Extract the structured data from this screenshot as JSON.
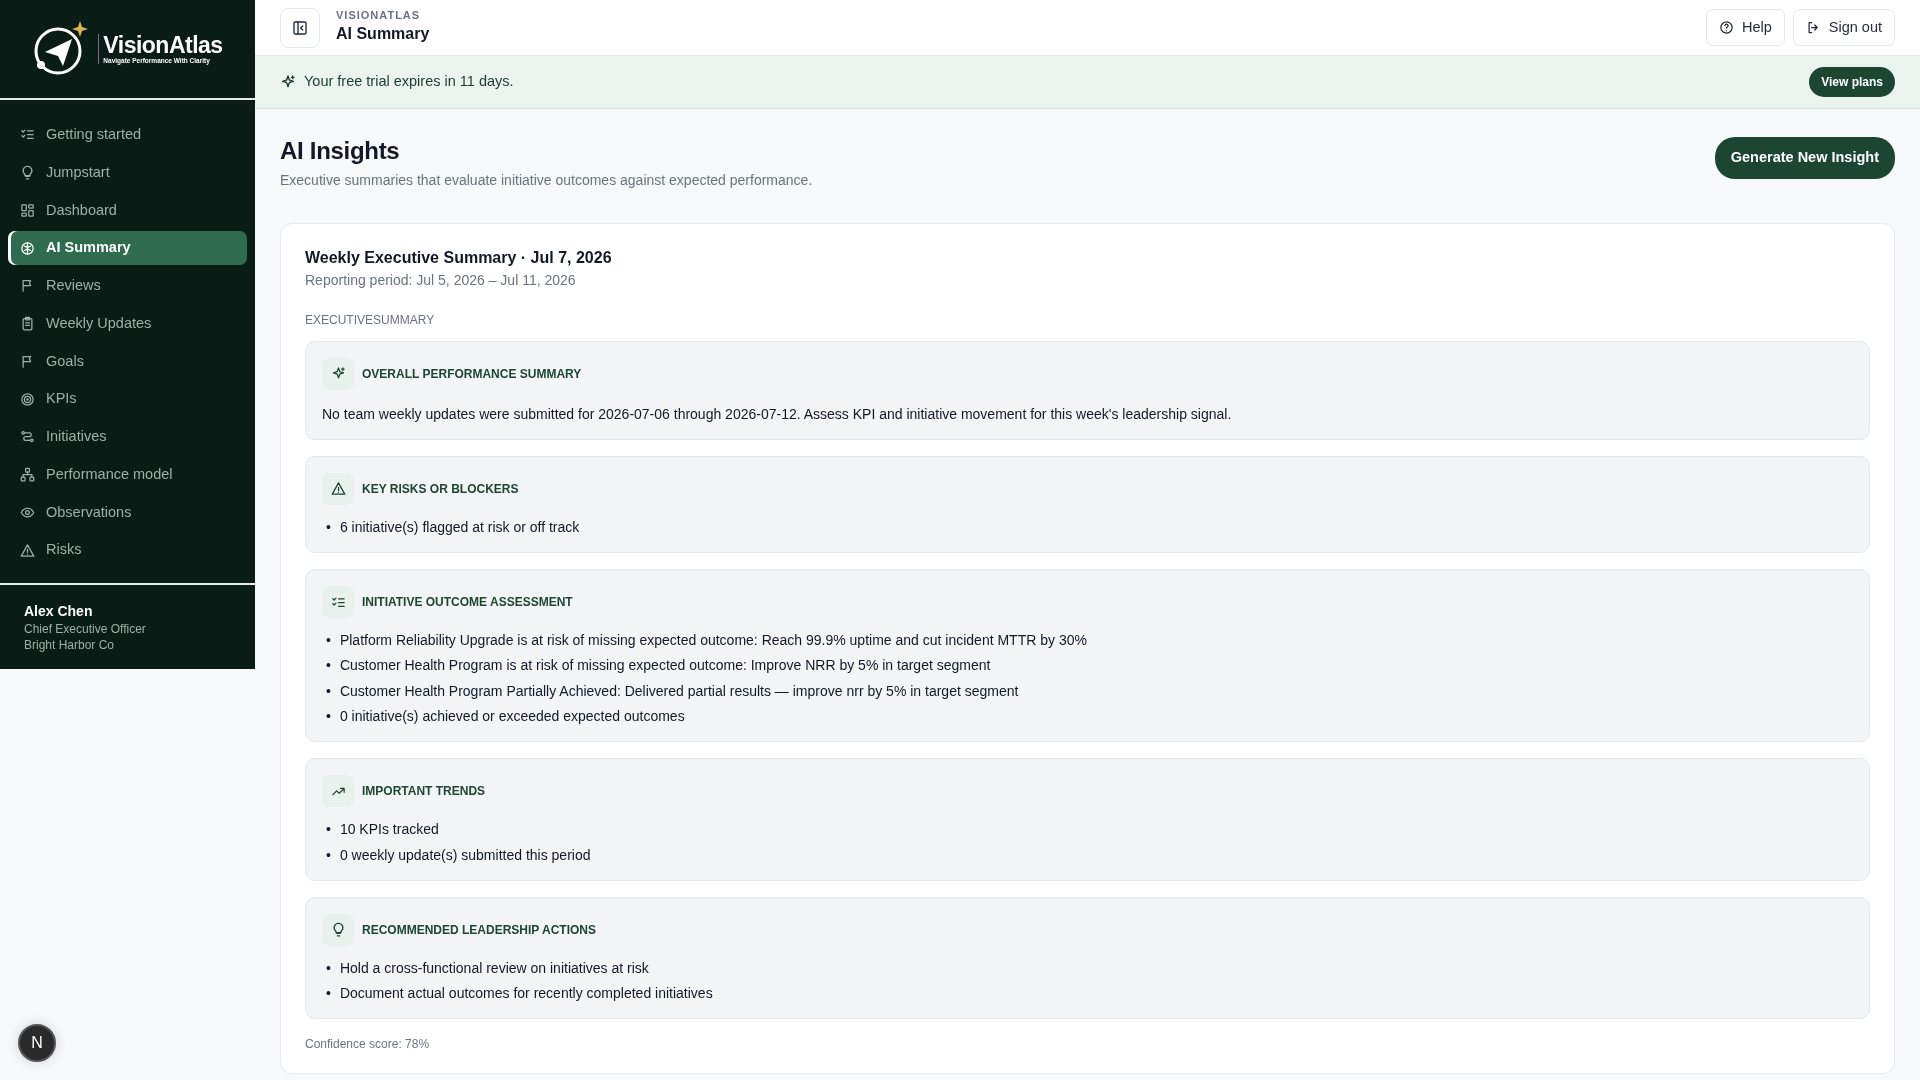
{
  "brand": {
    "name": "VisionAtlas",
    "tagline": "Navigate Performance With Clarity"
  },
  "sidebar": {
    "items": [
      {
        "label": "Getting started",
        "selected": false
      },
      {
        "label": "Jumpstart",
        "selected": false
      },
      {
        "label": "Dashboard",
        "selected": false
      },
      {
        "label": "AI Summary",
        "selected": true
      },
      {
        "label": "Reviews",
        "selected": false
      },
      {
        "label": "Weekly Updates",
        "selected": false
      },
      {
        "label": "Goals",
        "selected": false
      },
      {
        "label": "KPIs",
        "selected": false
      },
      {
        "label": "Initiatives",
        "selected": false
      },
      {
        "label": "Performance model",
        "selected": false
      },
      {
        "label": "Observations",
        "selected": false
      },
      {
        "label": "Risks",
        "selected": false
      }
    ],
    "user": {
      "name": "Alex Chen",
      "role": "Chief Executive Officer",
      "company": "Bright Harbor Co"
    }
  },
  "header": {
    "eyebrow": "VISIONATLAS",
    "title": "AI Summary",
    "buttons": [
      "Help",
      "Sign out"
    ]
  },
  "banner": {
    "text": "Your free trial expires in 11 days.",
    "button": "View plans"
  },
  "page": {
    "title": "AI Insights",
    "subtitle": "Executive summaries that evaluate initiative outcomes against expected performance.",
    "button": "Generate New Insight"
  },
  "summary": {
    "title": "Weekly Executive Summary · Jul 7, 2026",
    "period": "Reporting period: Jul 5, 2026 – Jul 11, 2026",
    "label": "EXECUTIVESUMMARY",
    "sections": [
      {
        "kind": "paragraph",
        "heading": "OVERALL PERFORMANCE SUMMARY",
        "text": "No team weekly updates were submitted for 2026-07-06 through 2026-07-12. Assess KPI and initiative movement for this week's leadership signal."
      },
      {
        "kind": "list",
        "marker": "•",
        "heading": "KEY RISKS OR BLOCKERS",
        "items": [
          "6 initiative(s) flagged at risk or off track"
        ]
      },
      {
        "kind": "list",
        "marker": "•",
        "heading": "INITIATIVE OUTCOME ASSESSMENT",
        "items": [
          "Platform Reliability Upgrade is at risk of missing expected outcome: Reach 99.9% uptime and cut incident MTTR by 30%",
          "Customer Health Program is at risk of missing expected outcome: Improve NRR by 5% in target segment",
          "Customer Health Program Partially Achieved: Delivered partial results — improve nrr by 5% in target segment",
          "0 initiative(s) achieved or exceeded expected outcomes"
        ]
      },
      {
        "kind": "list",
        "marker": "•",
        "heading": "IMPORTANT TRENDS",
        "items": [
          "10 KPIs tracked",
          "0 weekly update(s) submitted this period"
        ]
      },
      {
        "kind": "list",
        "marker": "•",
        "heading": "RECOMMENDED LEADERSHIP ACTIONS",
        "items": [
          "Hold a cross-functional review on initiatives at risk",
          "Document actual outcomes for recently completed initiatives"
        ]
      }
    ],
    "confidence": "Confidence score: 78%"
  },
  "dev_indicator": "N"
}
